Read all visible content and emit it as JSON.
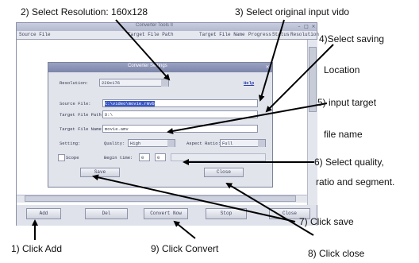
{
  "annotations": {
    "a2": "2) Select Resolution: 160x128",
    "a3": "3) Select original input vido",
    "a4a": "4)Select saving",
    "a4b": "Location",
    "a5a": "5) input target",
    "a5b": "file name",
    "a6a": "6) Select quality,",
    "a6b": "ratio and segment.",
    "a7": "7) Click save",
    "a1": "1) Click Add",
    "a9": "9) Click Convert",
    "a8": "8) Click close"
  },
  "app": {
    "title": "Converter Tools II",
    "columns": [
      "Source File",
      "Target File Path",
      "Target File Name",
      "Progress",
      "Status",
      "Resolution"
    ],
    "buttons": {
      "add": "Add",
      "del": "Del",
      "convert": "Convert Now",
      "stop": "Stop",
      "close": "Close"
    }
  },
  "dialog": {
    "title": "Converter Settings",
    "resolution_label": "Resolution:",
    "resolution_value": "220x176",
    "help": "Help",
    "source_label": "Source File:",
    "source_value": "C:\\video\\movie.rmvb",
    "path_label": "Target File Path:",
    "path_value": "D:\\",
    "name_label": "Target File Name:",
    "name_value": "movie.amv",
    "setting_label": "Setting:",
    "quality_label": "Quality:",
    "quality_value": "High",
    "ratio_label": "Aspect Ratio:",
    "ratio_value": "Full",
    "scope_label": "Scope",
    "begin_label": "Begin time:",
    "begin_h": "0",
    "begin_m": "0",
    "save": "Save",
    "close": "Close"
  }
}
